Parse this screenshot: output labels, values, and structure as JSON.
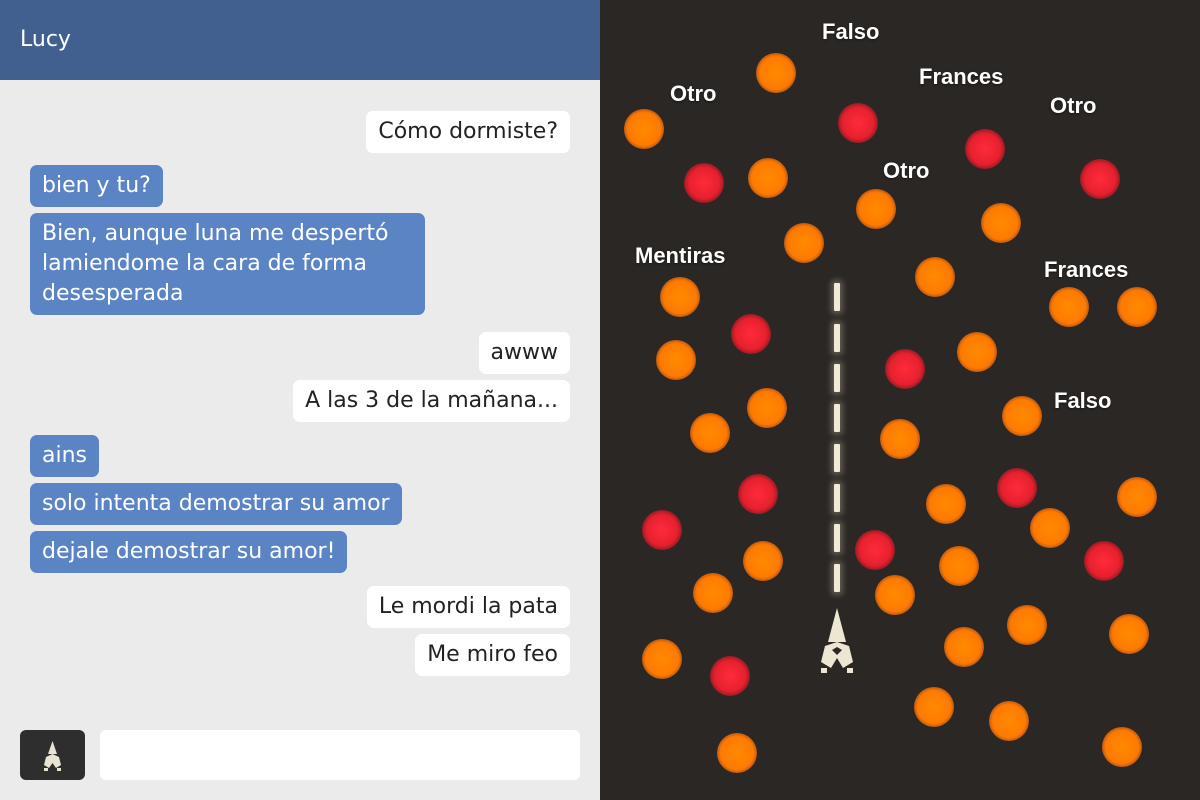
{
  "chat": {
    "title": "Lucy",
    "messages": [
      {
        "from": "me",
        "text": "Cómo dormiste?"
      },
      {
        "from": "other",
        "text": "bien y tu?"
      },
      {
        "from": "other",
        "text": "Bien, aunque luna me despertó\nlamiendome la cara de forma\ndesesperada"
      },
      {
        "from": "me",
        "text": "awww"
      },
      {
        "from": "me",
        "text": "A las 3 de la mañana..."
      },
      {
        "from": "other",
        "text": "ains"
      },
      {
        "from": "other",
        "text": "solo intenta demostrar su amor"
      },
      {
        "from": "other",
        "text": "dejale demostrar su amor!"
      },
      {
        "from": "me",
        "text": "Le mordi la pata"
      },
      {
        "from": "me",
        "text": "Me miro feo"
      }
    ],
    "composer": {
      "value": "",
      "placeholder": "",
      "button_icon": "ship-icon"
    }
  },
  "game": {
    "words": [
      "Falso",
      "Frances",
      "Otro",
      "Otro",
      "Otro",
      "Mentiras",
      "Frances",
      "Falso"
    ],
    "orb_colors": {
      "orange": "#ff7a00",
      "red": "#e6202f"
    },
    "background": "#2b2724",
    "player_icon": "ship-icon"
  },
  "colors": {
    "header": "#41608f",
    "bubble_other": "#5b84c4",
    "bubble_me": "#ffffff",
    "chat_bg": "#ebebeb"
  }
}
